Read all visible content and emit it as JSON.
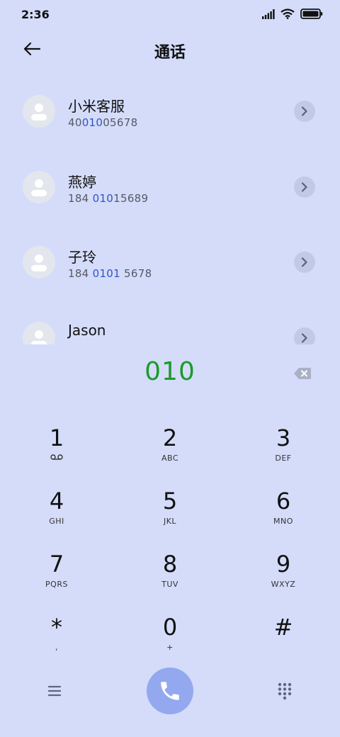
{
  "status": {
    "time": "2:36"
  },
  "header": {
    "title": "通话"
  },
  "contacts": [
    {
      "name": "小米客服",
      "number_pre": "40",
      "number_hl": "010",
      "number_post": "05678"
    },
    {
      "name": "燕婷",
      "number_pre": "184 ",
      "number_hl": "010",
      "number_post": "15689"
    },
    {
      "name": "子玲",
      "number_pre": "184 ",
      "number_hl": "0101",
      "number_post": " 5678"
    },
    {
      "name": "Jason",
      "number_pre": "",
      "number_hl": "",
      "number_post": ""
    }
  ],
  "dialed_number": "010",
  "keypad": [
    {
      "digit": "1",
      "letters": ""
    },
    {
      "digit": "2",
      "letters": "ABC"
    },
    {
      "digit": "3",
      "letters": "DEF"
    },
    {
      "digit": "4",
      "letters": "GHI"
    },
    {
      "digit": "5",
      "letters": "JKL"
    },
    {
      "digit": "6",
      "letters": "MNO"
    },
    {
      "digit": "7",
      "letters": "PQRS"
    },
    {
      "digit": "8",
      "letters": "TUV"
    },
    {
      "digit": "9",
      "letters": "WXYZ"
    },
    {
      "digit": "*",
      "letters": ","
    },
    {
      "digit": "0",
      "letters": "+"
    },
    {
      "digit": "#",
      "letters": ""
    }
  ],
  "icons": {
    "back": "arrow-left-icon",
    "backspace": "backspace-icon",
    "voicemail": "voicemail-icon",
    "menu": "menu-icon",
    "call": "phone-icon",
    "grid": "dialpad-grid-icon"
  },
  "colors": {
    "background": "#d4dcfa",
    "dialed": "#1c9a2a",
    "highlight": "#2f55c8",
    "call_button": "#93a8ef"
  }
}
